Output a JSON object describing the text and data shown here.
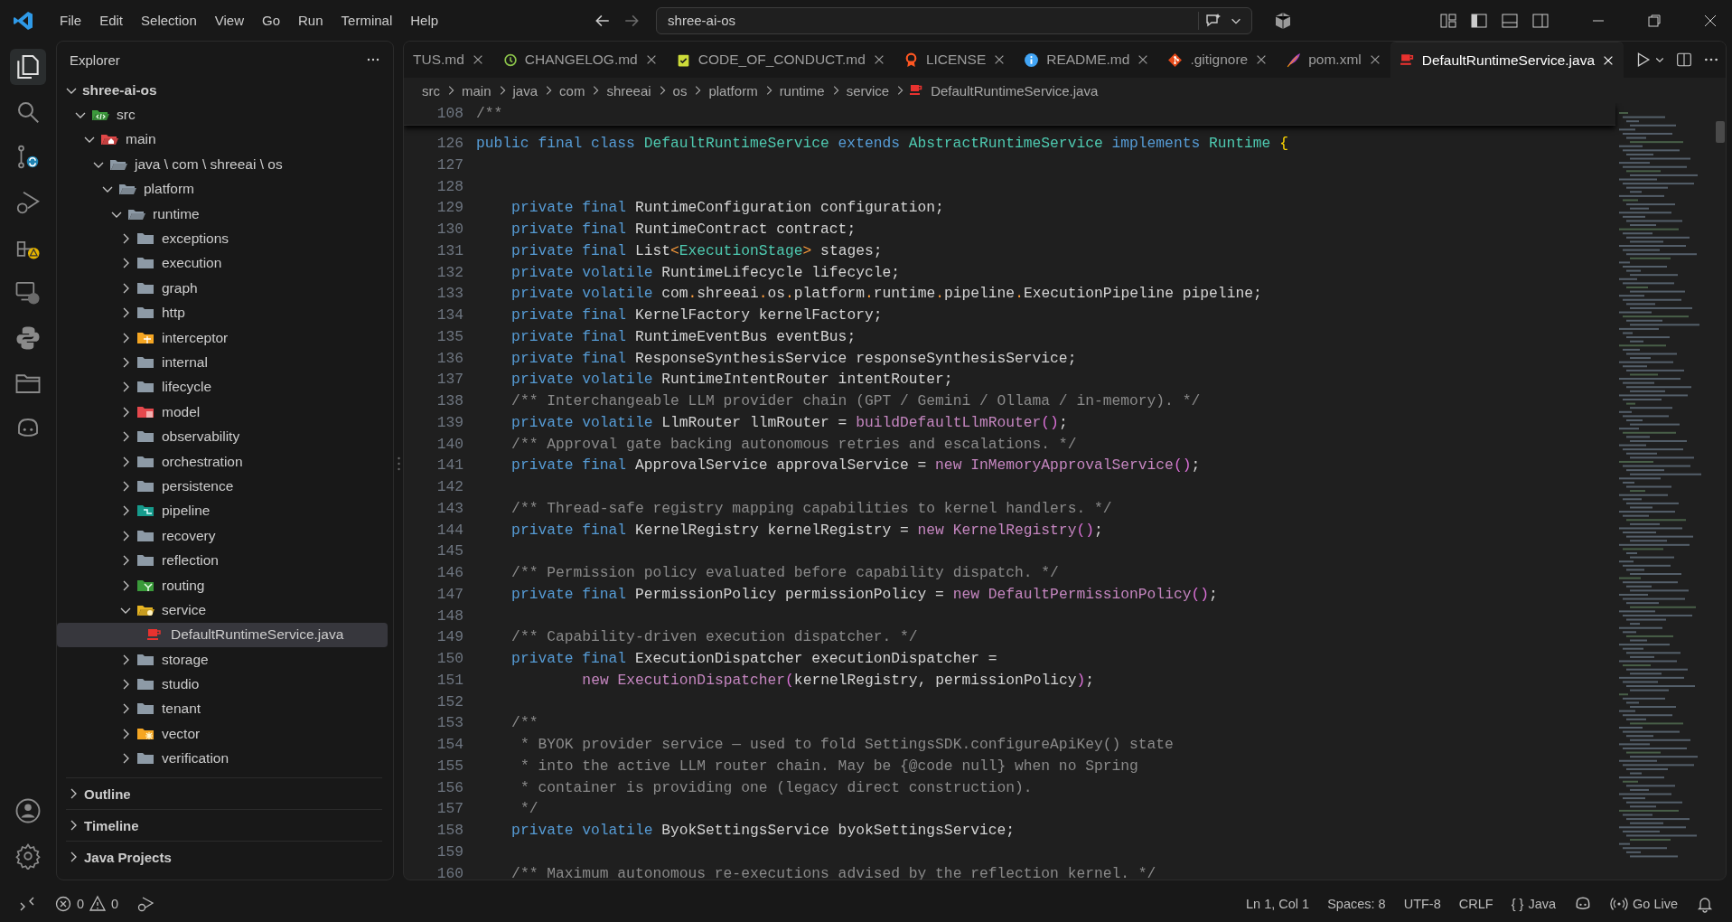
{
  "menu": [
    "File",
    "Edit",
    "Selection",
    "View",
    "Go",
    "Run",
    "Terminal",
    "Help"
  ],
  "search": {
    "value": "shree-ai-os"
  },
  "explorer": {
    "title": "Explorer",
    "tree": {
      "label": "shree-ai-os",
      "kind": "root",
      "expanded": true,
      "children": [
        {
          "label": "src",
          "kind": "src",
          "expanded": true,
          "children": [
            {
              "label": "main",
              "kind": "main",
              "expanded": true,
              "children": [
                {
                  "label": "java \\ com \\ shreeai \\ os",
                  "kind": "folder",
                  "expanded": true,
                  "children": [
                    {
                      "label": "platform",
                      "kind": "folder",
                      "expanded": true,
                      "children": [
                        {
                          "label": "runtime",
                          "kind": "folder",
                          "expanded": true,
                          "children": [
                            {
                              "label": "exceptions",
                              "kind": "folder",
                              "expanded": false
                            },
                            {
                              "label": "execution",
                              "kind": "folder",
                              "expanded": false
                            },
                            {
                              "label": "graph",
                              "kind": "folder",
                              "expanded": false
                            },
                            {
                              "label": "http",
                              "kind": "folder",
                              "expanded": false
                            },
                            {
                              "label": "interceptor",
                              "kind": "interceptor",
                              "expanded": false
                            },
                            {
                              "label": "internal",
                              "kind": "folder",
                              "expanded": false
                            },
                            {
                              "label": "lifecycle",
                              "kind": "folder",
                              "expanded": false
                            },
                            {
                              "label": "model",
                              "kind": "model",
                              "expanded": false
                            },
                            {
                              "label": "observability",
                              "kind": "folder",
                              "expanded": false
                            },
                            {
                              "label": "orchestration",
                              "kind": "folder",
                              "expanded": false
                            },
                            {
                              "label": "persistence",
                              "kind": "folder",
                              "expanded": false
                            },
                            {
                              "label": "pipeline",
                              "kind": "pipeline",
                              "expanded": false
                            },
                            {
                              "label": "recovery",
                              "kind": "folder",
                              "expanded": false
                            },
                            {
                              "label": "reflection",
                              "kind": "folder",
                              "expanded": false
                            },
                            {
                              "label": "routing",
                              "kind": "routing",
                              "expanded": false
                            },
                            {
                              "label": "service",
                              "kind": "service",
                              "expanded": true,
                              "children": [
                                {
                                  "label": "DefaultRuntimeService.java",
                                  "kind": "java",
                                  "selected": true
                                }
                              ]
                            },
                            {
                              "label": "storage",
                              "kind": "folder",
                              "expanded": false
                            },
                            {
                              "label": "studio",
                              "kind": "folder",
                              "expanded": false
                            },
                            {
                              "label": "tenant",
                              "kind": "folder",
                              "expanded": false
                            },
                            {
                              "label": "vector",
                              "kind": "vector",
                              "expanded": false
                            },
                            {
                              "label": "verification",
                              "kind": "folder",
                              "expanded": false
                            }
                          ]
                        }
                      ]
                    }
                  ]
                }
              ]
            }
          ]
        }
      ]
    },
    "sections": [
      {
        "label": "Outline",
        "expanded": false
      },
      {
        "label": "Timeline",
        "expanded": false
      },
      {
        "label": "Java Projects",
        "expanded": false
      }
    ]
  },
  "tabs": [
    {
      "label": "TUS.md",
      "kind": "markdown",
      "selected": false
    },
    {
      "label": "CHANGELOG.md",
      "kind": "history",
      "selected": false
    },
    {
      "label": "CODE_OF_CONDUCT.md",
      "kind": "clipboard",
      "selected": false
    },
    {
      "label": "LICENSE",
      "kind": "ribbon",
      "selected": false
    },
    {
      "label": "README.md",
      "kind": "info",
      "selected": false
    },
    {
      "label": ".gitignore",
      "kind": "git",
      "selected": false
    },
    {
      "label": "pom.xml",
      "kind": "feather",
      "selected": false
    },
    {
      "label": "DefaultRuntimeService.java",
      "kind": "java",
      "selected": true
    }
  ],
  "breadcrumbs": [
    "src",
    "main",
    "java",
    "com",
    "shreeai",
    "os",
    "platform",
    "runtime",
    "service",
    "DefaultRuntimeService.java"
  ],
  "sticky_line": {
    "number": "108",
    "tokens": [
      {
        "kind": "comment",
        "text": "/**"
      }
    ]
  },
  "code": [
    {
      "number": "126",
      "kind": "top",
      "tokens": [
        {
          "kind": "keyword",
          "text": "public final class "
        },
        {
          "kind": "type",
          "text": "DefaultRuntimeService"
        },
        {
          "kind": "keyword",
          "text": " extends "
        },
        {
          "kind": "type",
          "text": "AbstractRuntimeService"
        },
        {
          "kind": "keyword",
          "text": " implements "
        },
        {
          "kind": "type",
          "text": "Runtime "
        },
        {
          "kind": "brace",
          "text": "{"
        }
      ]
    },
    {
      "number": "127"
    },
    {
      "number": "128"
    },
    {
      "number": "129",
      "kind": "member",
      "tokens": [
        {
          "kind": "keyword",
          "text": "private final"
        },
        {
          "kind": "plain",
          "text": " RuntimeConfiguration configuration;"
        }
      ]
    },
    {
      "number": "130",
      "kind": "member",
      "tokens": [
        {
          "kind": "keyword",
          "text": "private final"
        },
        {
          "kind": "plain",
          "text": " RuntimeContract contract;"
        }
      ]
    },
    {
      "number": "131",
      "kind": "member",
      "tokens": [
        {
          "kind": "keyword",
          "text": "private final"
        },
        {
          "kind": "plain",
          "text": " List"
        },
        {
          "kind": "operator",
          "text": "<"
        },
        {
          "kind": "type",
          "text": "ExecutionStage"
        },
        {
          "kind": "operator",
          "text": ">"
        },
        {
          "kind": "plain",
          "text": " stages;"
        }
      ]
    },
    {
      "number": "132",
      "kind": "member",
      "tokens": [
        {
          "kind": "keyword",
          "text": "private volatile"
        },
        {
          "kind": "plain",
          "text": " RuntimeLifecycle lifecycle;"
        }
      ]
    },
    {
      "number": "133",
      "kind": "member",
      "tokens": [
        {
          "kind": "keyword",
          "text": "private volatile"
        },
        {
          "kind": "plain",
          "text": " com"
        },
        {
          "kind": "operator",
          "text": "."
        },
        {
          "kind": "plain",
          "text": "shreeai"
        },
        {
          "kind": "operator",
          "text": "."
        },
        {
          "kind": "plain",
          "text": "os"
        },
        {
          "kind": "operator",
          "text": "."
        },
        {
          "kind": "plain",
          "text": "platform"
        },
        {
          "kind": "operator",
          "text": "."
        },
        {
          "kind": "plain",
          "text": "runtime"
        },
        {
          "kind": "operator",
          "text": "."
        },
        {
          "kind": "plain",
          "text": "pipeline"
        },
        {
          "kind": "operator",
          "text": "."
        },
        {
          "kind": "plain",
          "text": "ExecutionPipeline pipeline;"
        }
      ]
    },
    {
      "number": "134",
      "kind": "member",
      "tokens": [
        {
          "kind": "keyword",
          "text": "private final"
        },
        {
          "kind": "plain",
          "text": " KernelFactory kernelFactory;"
        }
      ]
    },
    {
      "number": "135",
      "kind": "member",
      "tokens": [
        {
          "kind": "keyword",
          "text": "private final"
        },
        {
          "kind": "plain",
          "text": " RuntimeEventBus eventBus;"
        }
      ]
    },
    {
      "number": "136",
      "kind": "member",
      "tokens": [
        {
          "kind": "keyword",
          "text": "private final"
        },
        {
          "kind": "plain",
          "text": " ResponseSynthesisService responseSynthesisService;"
        }
      ]
    },
    {
      "number": "137",
      "kind": "member",
      "tokens": [
        {
          "kind": "keyword",
          "text": "private volatile"
        },
        {
          "kind": "plain",
          "text": " RuntimeIntentRouter intentRouter;"
        }
      ]
    },
    {
      "number": "138",
      "kind": "member",
      "tokens": [
        {
          "kind": "comment",
          "text": "/** Interchangeable LLM provider chain (GPT / Gemini / Ollama / in-memory). */"
        }
      ]
    },
    {
      "number": "139",
      "kind": "member",
      "tokens": [
        {
          "kind": "keyword",
          "text": "private volatile"
        },
        {
          "kind": "plain",
          "text": " LlmRouter llmRouter = "
        },
        {
          "kind": "call",
          "text": "buildDefaultLlmRouter"
        },
        {
          "kind": "paren",
          "text": "()"
        },
        {
          "kind": "plain",
          "text": ";"
        }
      ]
    },
    {
      "number": "140",
      "kind": "member",
      "tokens": [
        {
          "kind": "comment",
          "text": "/** Approval gate backing autonomous retries and escalations. */"
        }
      ]
    },
    {
      "number": "141",
      "kind": "member",
      "tokens": [
        {
          "kind": "keyword",
          "text": "private final"
        },
        {
          "kind": "plain",
          "text": " ApprovalService approvalService = "
        },
        {
          "kind": "call",
          "text": "new InMemoryApprovalService"
        },
        {
          "kind": "paren",
          "text": "()"
        },
        {
          "kind": "plain",
          "text": ";"
        }
      ]
    },
    {
      "number": "142"
    },
    {
      "number": "143",
      "kind": "member",
      "tokens": [
        {
          "kind": "comment",
          "text": "/** Thread-safe registry mapping capabilities to kernel handlers. */"
        }
      ]
    },
    {
      "number": "144",
      "kind": "member",
      "tokens": [
        {
          "kind": "keyword",
          "text": "private final"
        },
        {
          "kind": "plain",
          "text": " KernelRegistry kernelRegistry = "
        },
        {
          "kind": "call",
          "text": "new KernelRegistry"
        },
        {
          "kind": "paren",
          "text": "()"
        },
        {
          "kind": "plain",
          "text": ";"
        }
      ]
    },
    {
      "number": "145"
    },
    {
      "number": "146",
      "kind": "member",
      "tokens": [
        {
          "kind": "comment",
          "text": "/** Permission policy evaluated before capability dispatch. */"
        }
      ]
    },
    {
      "number": "147",
      "kind": "member",
      "tokens": [
        {
          "kind": "keyword",
          "text": "private final"
        },
        {
          "kind": "plain",
          "text": " PermissionPolicy permissionPolicy = "
        },
        {
          "kind": "call",
          "text": "new DefaultPermissionPolicy"
        },
        {
          "kind": "paren",
          "text": "()"
        },
        {
          "kind": "plain",
          "text": ";"
        }
      ]
    },
    {
      "number": "148"
    },
    {
      "number": "149",
      "kind": "member",
      "tokens": [
        {
          "kind": "comment",
          "text": "/** Capability-driven execution dispatcher. */"
        }
      ]
    },
    {
      "number": "150",
      "kind": "member",
      "tokens": [
        {
          "kind": "keyword",
          "text": "private final"
        },
        {
          "kind": "plain",
          "text": " ExecutionDispatcher executionDispatcher ="
        }
      ]
    },
    {
      "number": "151",
      "kind": "continued",
      "tokens": [
        {
          "kind": "call",
          "text": "new ExecutionDispatcher"
        },
        {
          "kind": "paren",
          "text": "("
        },
        {
          "kind": "plain",
          "text": "kernelRegistry, permissionPolicy"
        },
        {
          "kind": "paren",
          "text": ")"
        },
        {
          "kind": "plain",
          "text": ";"
        }
      ]
    },
    {
      "number": "152"
    },
    {
      "number": "153",
      "kind": "member",
      "tokens": [
        {
          "kind": "comment",
          "text": "/**"
        }
      ]
    },
    {
      "number": "154",
      "kind": "member",
      "tokens": [
        {
          "kind": "comment",
          "text": " * BYOK provider service — used to fold SettingsSDK.configureApiKey() state"
        }
      ]
    },
    {
      "number": "155",
      "kind": "member",
      "tokens": [
        {
          "kind": "comment",
          "text": " * into the active LLM router chain. May be {@code null} when no Spring"
        }
      ]
    },
    {
      "number": "156",
      "kind": "member",
      "tokens": [
        {
          "kind": "comment",
          "text": " * container is providing one (legacy direct construction)."
        }
      ]
    },
    {
      "number": "157",
      "kind": "member",
      "tokens": [
        {
          "kind": "comment",
          "text": " */"
        }
      ]
    },
    {
      "number": "158",
      "kind": "member",
      "tokens": [
        {
          "kind": "keyword",
          "text": "private volatile"
        },
        {
          "kind": "plain",
          "text": " ByokSettingsService byokSettingsService;"
        }
      ]
    },
    {
      "number": "159"
    },
    {
      "number": "160",
      "kind": "member",
      "tokens": [
        {
          "kind": "comment",
          "text": "/** Maximum autonomous re-executions advised by the reflection kernel. */"
        }
      ]
    }
  ],
  "status_bar": {
    "errors": "0",
    "warnings": "0",
    "items": [
      "Ln 1, Col 1",
      "Spaces: 8",
      "UTF-8",
      "CRLF"
    ],
    "language_icon": "{ }",
    "language": "Java",
    "live": "Go Live"
  }
}
